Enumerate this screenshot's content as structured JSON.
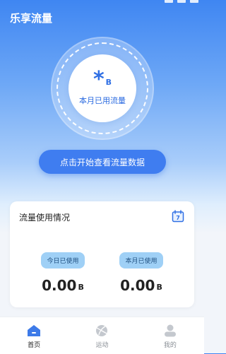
{
  "app": {
    "title": "乐享流量"
  },
  "meter": {
    "value": "*",
    "unit": "B",
    "label": "本月已用流量"
  },
  "start_button": {
    "label": "点击开始查看流量数据"
  },
  "usage_card": {
    "title": "流量使用情况",
    "calendar_day": "7",
    "today": {
      "label": "今日已使用",
      "value": "0.00",
      "unit": "B"
    },
    "month": {
      "label": "本月已使用",
      "value": "0.00",
      "unit": "B"
    }
  },
  "tabs": [
    {
      "label": "首页",
      "icon": "home-icon",
      "active": true
    },
    {
      "label": "运动",
      "icon": "ball-icon",
      "active": false
    },
    {
      "label": "我的",
      "icon": "profile-icon",
      "active": false
    }
  ],
  "colors": {
    "accent": "#3f7df0",
    "badge": "#9fd0f6",
    "active_tab": "#3d7ae8",
    "inactive_tab": "#c4c8ce"
  }
}
